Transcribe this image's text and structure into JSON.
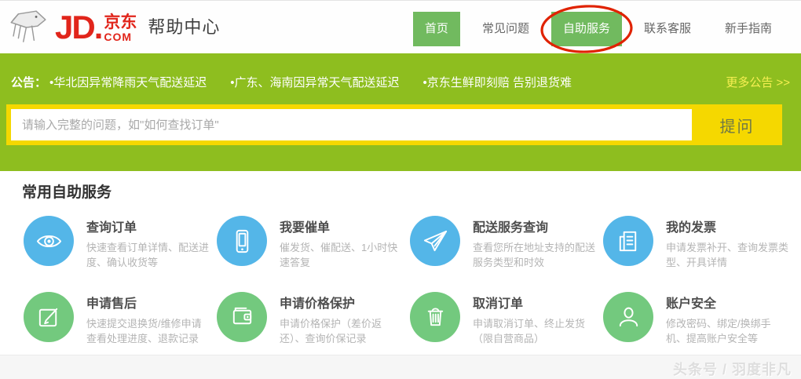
{
  "header": {
    "logo": {
      "jd": "JD.",
      "cn": "京东",
      "com": "COM",
      "title": "帮助中心"
    },
    "nav": [
      {
        "name": "home",
        "label": "首页",
        "active": true,
        "circled": false
      },
      {
        "name": "faq",
        "label": "常见问题",
        "active": false,
        "circled": false
      },
      {
        "name": "self-service",
        "label": "自助服务",
        "active": true,
        "circled": true
      },
      {
        "name": "contact",
        "label": "联系客服",
        "active": false,
        "circled": false
      },
      {
        "name": "guide",
        "label": "新手指南",
        "active": false,
        "circled": false
      }
    ]
  },
  "notice": {
    "label": "公告：",
    "items": [
      "•华北因异常降雨天气配送延迟",
      "•广东、海南因异常天气配送延迟",
      "•京东生鲜即刻赔 告别退货难"
    ],
    "more": "更多公告 >>"
  },
  "search": {
    "placeholder": "请输入完整的问题，如\"如何查找订单\"",
    "button": "提问"
  },
  "main": {
    "heading": "常用自助服务",
    "services": [
      {
        "name": "query-order",
        "title": "查询订单",
        "desc": "快速查看订单详情、配送进度、确认收货等",
        "icon": "eye-icon",
        "color": "#54b6e8"
      },
      {
        "name": "urge-order",
        "title": "我要催单",
        "desc": "催发货、催配送、1小时快速答复",
        "icon": "phone-icon",
        "color": "#54b6e8"
      },
      {
        "name": "delivery-service-query",
        "title": "配送服务查询",
        "desc": "查看您所在地址支持的配送服务类型和时效",
        "icon": "paper-plane-icon",
        "color": "#54b6e8"
      },
      {
        "name": "my-invoice",
        "title": "我的发票",
        "desc": "申请发票补开、查询发票类型、开具详情",
        "icon": "invoice-icon",
        "color": "#54b6e8"
      },
      {
        "name": "after-sales",
        "title": "申请售后",
        "desc": "快速提交退换货/维修申请 查看处理进度、退款记录",
        "icon": "edit-icon",
        "color": "#73c97e"
      },
      {
        "name": "price-protection",
        "title": "申请价格保护",
        "desc": "申请价格保护（差价返还）、查询价保记录",
        "icon": "wallet-icon",
        "color": "#73c97e"
      },
      {
        "name": "cancel-order",
        "title": "取消订单",
        "desc": "申请取消订单、终止发货（限自营商品）",
        "icon": "trash-icon",
        "color": "#73c97e"
      },
      {
        "name": "account-security",
        "title": "账户安全",
        "desc": "修改密码、绑定/换绑手机、提高账户安全等",
        "icon": "person-icon",
        "color": "#73c97e"
      }
    ]
  },
  "footer": {
    "watermark": "头条号 / 羽度非凡"
  },
  "colors": {
    "jd_red": "#e1251b",
    "band_green": "#8ebe1f",
    "tab_green": "#71ba5f",
    "accent_yellow": "#f5d800",
    "service_blue": "#54b6e8",
    "service_green": "#73c97e",
    "annotation_red": "#e02200"
  }
}
